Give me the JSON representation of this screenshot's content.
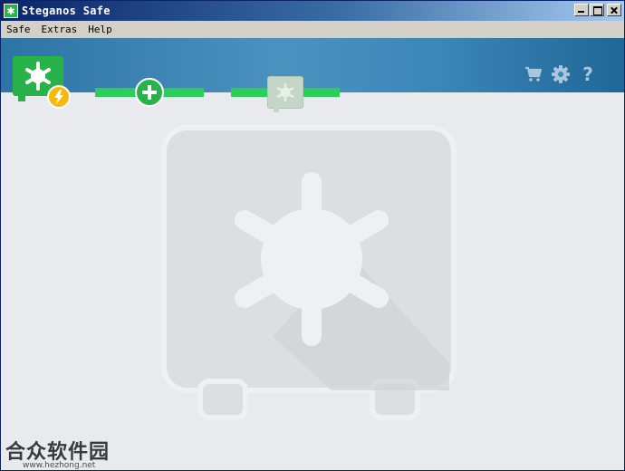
{
  "window": {
    "title": "Steganos Safe",
    "icon": "steganos-app-icon"
  },
  "menubar": {
    "items": [
      {
        "label": "Safe"
      },
      {
        "label": "Extras"
      },
      {
        "label": "Help"
      }
    ]
  },
  "wizard": {
    "steps": [
      {
        "icon": "safe-wheel-icon",
        "state": "active"
      },
      {
        "icon": "plus-icon",
        "state": "add"
      },
      {
        "icon": "safe-icon",
        "state": "disabled"
      }
    ],
    "badge_icon": "lightning-icon"
  },
  "toolbar": {
    "icons": [
      "cart-icon",
      "gear-icon",
      "help-icon"
    ],
    "help_label": "?"
  },
  "colors": {
    "accent_green": "#27b24a",
    "header_blue": "#3c86b8",
    "badge_yellow": "#f5b90f"
  },
  "watermark": {
    "text": "合众软件园",
    "url": "www.hezhong.net"
  }
}
